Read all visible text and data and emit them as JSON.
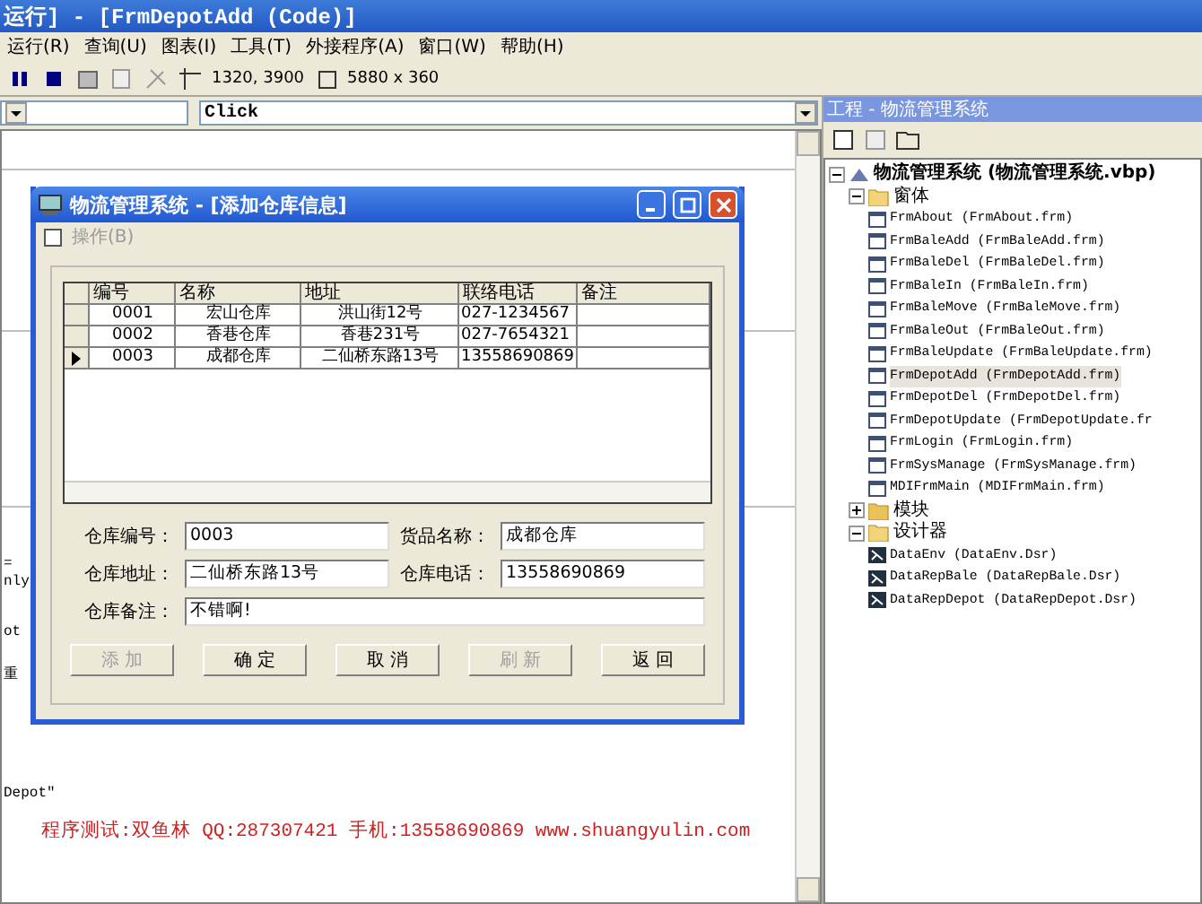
{
  "window": {
    "title": "运行] - [FrmDepotAdd (Code)]"
  },
  "menu": [
    {
      "label": "运行(R)"
    },
    {
      "label": "查询(U)"
    },
    {
      "label": "图表(I)"
    },
    {
      "label": "工具(T)"
    },
    {
      "label": "外接程序(A)"
    },
    {
      "label": "窗口(W)"
    },
    {
      "label": "帮助(H)"
    }
  ],
  "toolbar": {
    "position": "1320, 3900",
    "size": "5880 x 360"
  },
  "code_window": {
    "procedure_combo": "Click",
    "code_lines": [
      {
        "text": "="
      },
      {
        "text": "nly"
      },
      {
        "text": "ot"
      },
      {
        "text": "重"
      },
      {
        "text": "Depot\""
      }
    ],
    "credit": "程序测试:双鱼林 QQ:287307421 手机:13558690869 www.shuangyulin.com"
  },
  "dialog": {
    "title": "物流管理系统 - [添加仓库信息]",
    "menu": "操作(B)",
    "table": {
      "columns": [
        "编号",
        "名称",
        "地址",
        "联络电话",
        "备注"
      ],
      "rows": [
        {
          "cells": [
            "0001",
            "宏山仓库",
            "洪山街12号",
            "027-1234567",
            ""
          ],
          "selected": false
        },
        {
          "cells": [
            "0002",
            "香巷仓库",
            "香巷231号",
            "027-7654321",
            ""
          ],
          "selected": false
        },
        {
          "cells": [
            "0003",
            "成都仓库",
            "二仙桥东路13号",
            "13558690869",
            ""
          ],
          "selected": true
        }
      ]
    },
    "fields": [
      {
        "label": "仓库编号：",
        "value": "0003"
      },
      {
        "label": "货品名称：",
        "value": "成都仓库"
      },
      {
        "label": "仓库地址：",
        "value": "二仙桥东路13号"
      },
      {
        "label": "仓库电话：",
        "value": "13558690869"
      },
      {
        "label": "仓库备注：",
        "value": "不错啊!"
      }
    ],
    "buttons": [
      {
        "label": "添 加",
        "disabled": true
      },
      {
        "label": "确 定",
        "disabled": false
      },
      {
        "label": "取 消",
        "disabled": false
      },
      {
        "label": "刷 新",
        "disabled": true
      },
      {
        "label": "返 回",
        "disabled": false
      }
    ]
  },
  "project": {
    "title": "工程 - 物流管理系统",
    "tree": [
      {
        "label": "物流管理系统 (物流管理系统.vbp)",
        "kind": "project",
        "expanded": true,
        "children": [
          {
            "label": "窗体",
            "kind": "folder",
            "expanded": true,
            "children": [
              {
                "label": "FrmAbout (FrmAbout.frm)",
                "kind": "form",
                "selected": false
              },
              {
                "label": "FrmBaleAdd (FrmBaleAdd.frm)",
                "kind": "form",
                "selected": false
              },
              {
                "label": "FrmBaleDel (FrmBaleDel.frm)",
                "kind": "form",
                "selected": false
              },
              {
                "label": "FrmBaleIn (FrmBaleIn.frm)",
                "kind": "form",
                "selected": false
              },
              {
                "label": "FrmBaleMove (FrmBaleMove.frm)",
                "kind": "form",
                "selected": false
              },
              {
                "label": "FrmBaleOut (FrmBaleOut.frm)",
                "kind": "form",
                "selected": false
              },
              {
                "label": "FrmBaleUpdate (FrmBaleUpdate.frm)",
                "kind": "form",
                "selected": false
              },
              {
                "label": "FrmDepotAdd (FrmDepotAdd.frm)",
                "kind": "form",
                "selected": true
              },
              {
                "label": "FrmDepotDel (FrmDepotDel.frm)",
                "kind": "form",
                "selected": false
              },
              {
                "label": "FrmDepotUpdate (FrmDepotUpdate.fr",
                "kind": "form",
                "selected": false
              },
              {
                "label": "FrmLogin (FrmLogin.frm)",
                "kind": "form",
                "selected": false
              },
              {
                "label": "FrmSysManage (FrmSysManage.frm)",
                "kind": "form",
                "selected": false
              },
              {
                "label": "MDIFrmMain (MDIFrmMain.frm)",
                "kind": "form",
                "selected": false
              }
            ]
          },
          {
            "label": "模块",
            "kind": "folder",
            "expanded": false
          },
          {
            "label": "设计器",
            "kind": "folder",
            "expanded": true,
            "children": [
              {
                "label": "DataEnv (DataEnv.Dsr)",
                "kind": "designer",
                "selected": false
              },
              {
                "label": "DataRepBale (DataRepBale.Dsr)",
                "kind": "designer",
                "selected": false
              },
              {
                "label": "DataRepDepot (DataRepDepot.Dsr)",
                "kind": "designer",
                "selected": false
              }
            ]
          }
        ]
      }
    ]
  }
}
